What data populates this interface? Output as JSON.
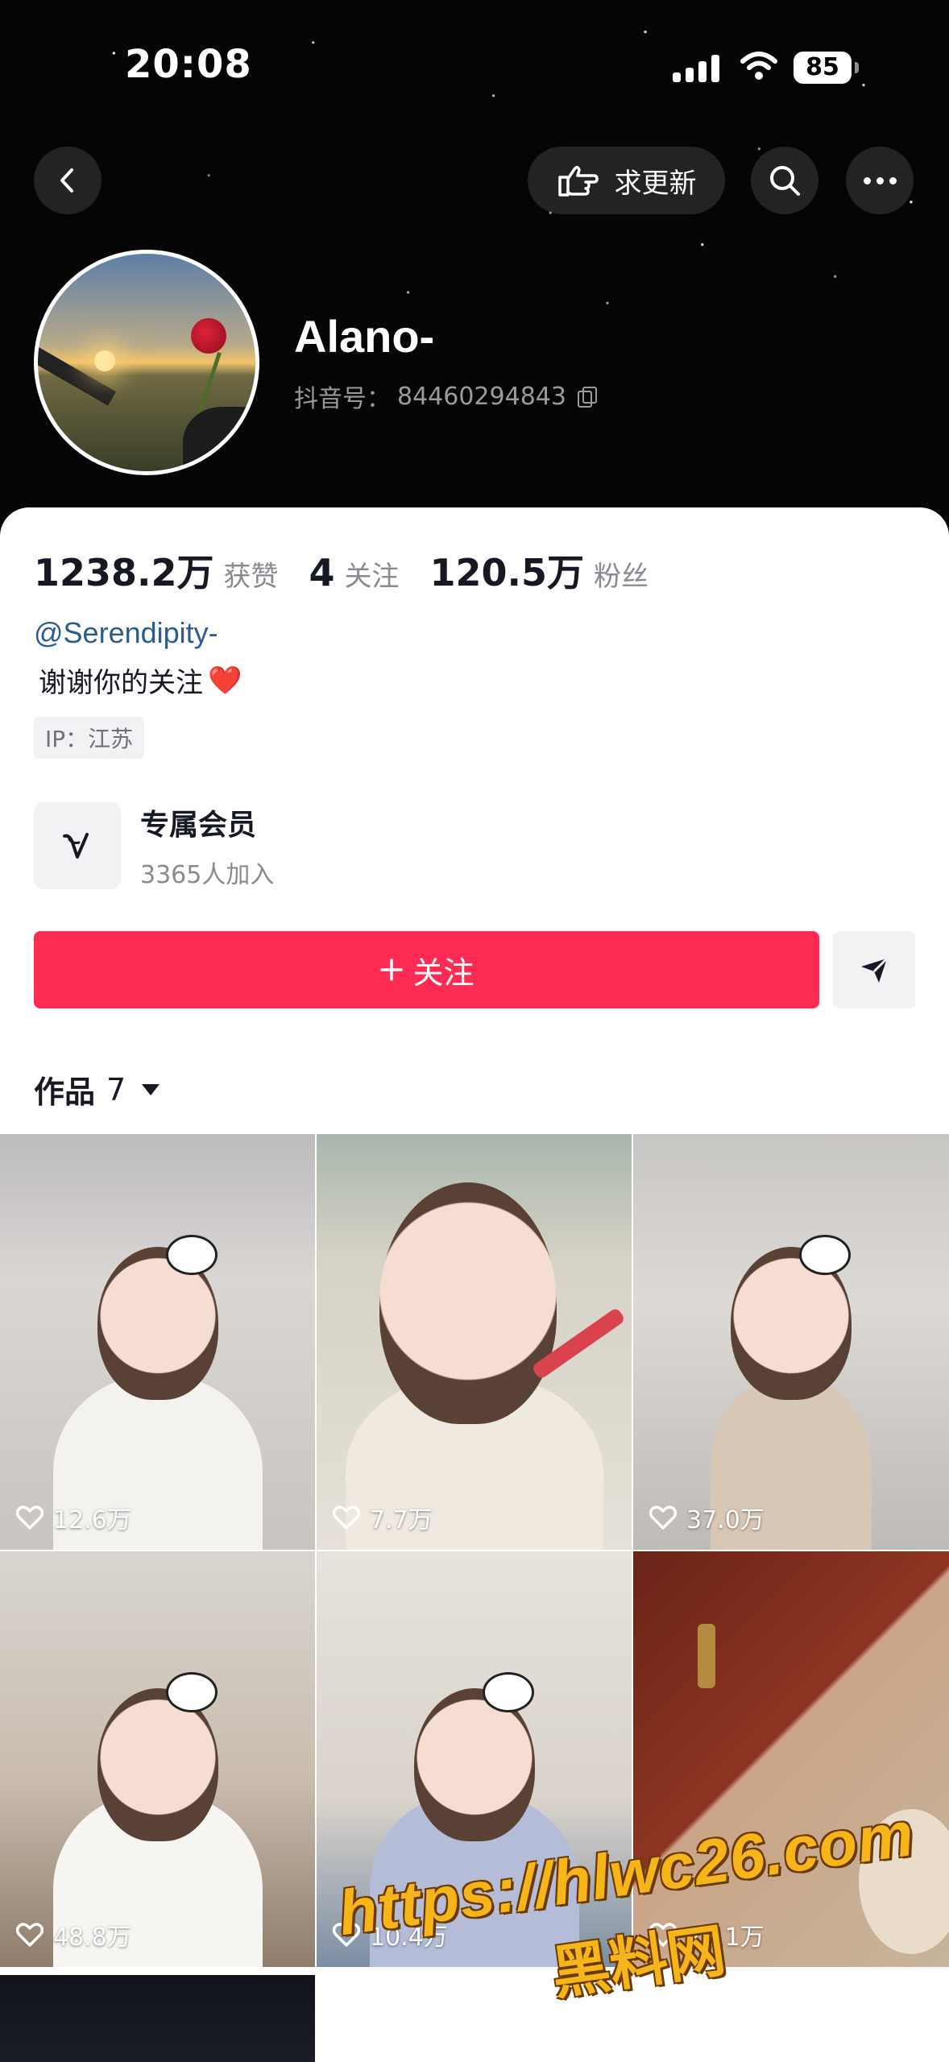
{
  "status_bar": {
    "time": "20:08",
    "battery": "85"
  },
  "top_actions": {
    "request_update_label": "求更新"
  },
  "profile": {
    "name": "Alano-",
    "douyin_id_label": "抖音号：",
    "douyin_id": "84460294843"
  },
  "stats": [
    {
      "value": "1238.2万",
      "label": "获赞"
    },
    {
      "value": "4",
      "label": "关注"
    },
    {
      "value": "120.5万",
      "label": "粉丝"
    }
  ],
  "bio": {
    "mention": "@Serendipity-",
    "text": "谢谢你的关注",
    "emoji": "❤️",
    "ip": "IP：江苏"
  },
  "membership": {
    "title": "专属会员",
    "subtitle": "3365人加入"
  },
  "actions": {
    "follow_label": "关注"
  },
  "works": {
    "label": "作品",
    "count": "7"
  },
  "videos": [
    {
      "likes": "12.6万"
    },
    {
      "likes": "7.7万"
    },
    {
      "likes": "37.0万"
    },
    {
      "likes": "48.8万"
    },
    {
      "likes": "10.4万"
    },
    {
      "likes": "22.1万"
    }
  ],
  "watermark": {
    "url": "https://hlwc26.com",
    "name": "黑料网"
  },
  "colors": {
    "follow_button": "#fe2c55",
    "mention": "#2a5d8f",
    "header_bg": "#050505"
  }
}
